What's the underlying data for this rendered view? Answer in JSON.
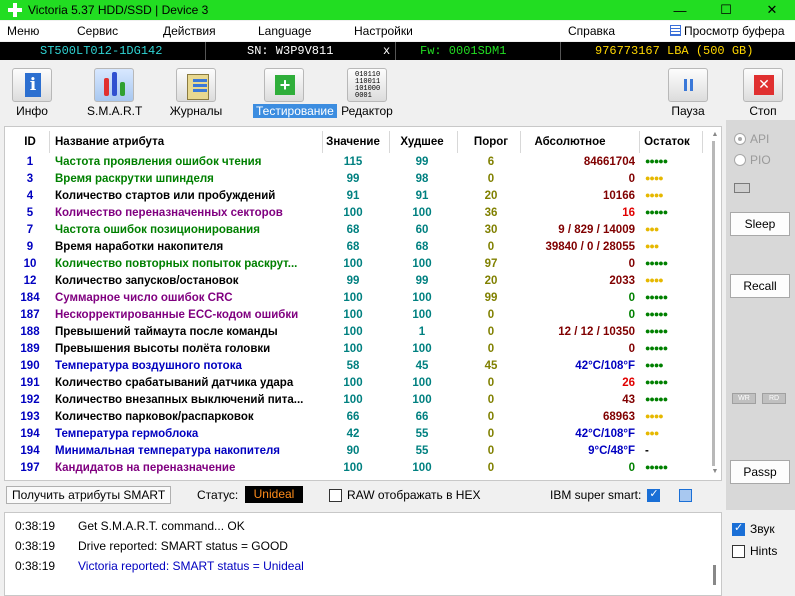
{
  "window": {
    "title": "Victoria 5.37 HDD/SSD | Device 3",
    "minimize": "—",
    "maximize": "☐",
    "close": "✕"
  },
  "menu": {
    "items": [
      "Меню",
      "Сервис",
      "Действия",
      "Language",
      "Настройки",
      "Справка"
    ],
    "buffer_view": "Просмотр буфера"
  },
  "drive_info": {
    "model": "ST500LT012-1DG142",
    "serial": "SN: W3P9V811",
    "eject": "x",
    "firmware": "Fw: 0001SDM1",
    "capacity": "976773167 LBA (500 GB)"
  },
  "toolbar": {
    "info": "Инфо",
    "smart": "S.M.A.R.T",
    "journals": "Журналы",
    "testing": "Тестирование",
    "editor": "Редактор",
    "pause": "Пауза",
    "stop": "Стоп",
    "editor_icon_lines": [
      "010110",
      "110011",
      "101000",
      "0001"
    ]
  },
  "smart_table": {
    "headers": {
      "id": "ID",
      "name": "Название атрибута",
      "value": "Значение",
      "worst": "Худшее",
      "threshold": "Порог",
      "raw": "Абсолютное",
      "remaining": "Остаток"
    },
    "rows": [
      {
        "id": "1",
        "name": "Частота проявления ошибок чтения",
        "value": "115",
        "worst": "99",
        "threshold": "6",
        "raw": "84661704",
        "dots": "●●●●●",
        "name_color": "#008000",
        "raw_color": "#800000",
        "dots_color": "#008000"
      },
      {
        "id": "3",
        "name": "Время раскрутки шпинделя",
        "value": "99",
        "worst": "98",
        "threshold": "0",
        "raw": "0",
        "dots": "●●●●",
        "name_color": "#008000",
        "raw_color": "#800000",
        "dots_color": "#e6b800"
      },
      {
        "id": "4",
        "name": "Количество стартов или пробуждений",
        "value": "91",
        "worst": "91",
        "threshold": "20",
        "raw": "10166",
        "dots": "●●●●",
        "name_color": "#000000",
        "raw_color": "#800000",
        "dots_color": "#e6b800"
      },
      {
        "id": "5",
        "name": "Количество переназначенных секторов",
        "value": "100",
        "worst": "100",
        "threshold": "36",
        "raw": "16",
        "dots": "●●●●●",
        "name_color": "#800080",
        "raw_color": "#e00000",
        "dots_color": "#008000"
      },
      {
        "id": "7",
        "name": "Частота ошибок позиционирования",
        "value": "68",
        "worst": "60",
        "threshold": "30",
        "raw": "9 / 829 / 14009",
        "dots": "●●●",
        "name_color": "#008000",
        "raw_color": "#800000",
        "dots_color": "#e6b800"
      },
      {
        "id": "9",
        "name": "Время наработки накопителя",
        "value": "68",
        "worst": "68",
        "threshold": "0",
        "raw": "39840 / 0 / 28055",
        "dots": "●●●",
        "name_color": "#000000",
        "raw_color": "#800000",
        "dots_color": "#e6b800"
      },
      {
        "id": "10",
        "name": "Количество повторных попыток раскрут...",
        "value": "100",
        "worst": "100",
        "threshold": "97",
        "raw": "0",
        "dots": "●●●●●",
        "name_color": "#008000",
        "raw_color": "#800000",
        "dots_color": "#008000"
      },
      {
        "id": "12",
        "name": "Количество запусков/остановок",
        "value": "99",
        "worst": "99",
        "threshold": "20",
        "raw": "2033",
        "dots": "●●●●",
        "name_color": "#000000",
        "raw_color": "#800000",
        "dots_color": "#e6b800"
      },
      {
        "id": "184",
        "name": "Суммарное число ошибок CRC",
        "value": "100",
        "worst": "100",
        "threshold": "99",
        "raw": "0",
        "dots": "●●●●●",
        "name_color": "#800080",
        "raw_color": "#008000",
        "dots_color": "#008000"
      },
      {
        "id": "187",
        "name": "Нескорректированные ECC-кодом ошибки",
        "value": "100",
        "worst": "100",
        "threshold": "0",
        "raw": "0",
        "dots": "●●●●●",
        "name_color": "#800080",
        "raw_color": "#008000",
        "dots_color": "#008000"
      },
      {
        "id": "188",
        "name": "Превышений таймаута после команды",
        "value": "100",
        "worst": "1",
        "threshold": "0",
        "raw": "12 / 12 / 10350",
        "dots": "●●●●●",
        "name_color": "#000000",
        "raw_color": "#800000",
        "dots_color": "#008000"
      },
      {
        "id": "189",
        "name": "Превышения высоты полёта головки",
        "value": "100",
        "worst": "100",
        "threshold": "0",
        "raw": "0",
        "dots": "●●●●●",
        "name_color": "#000000",
        "raw_color": "#800000",
        "dots_color": "#008000"
      },
      {
        "id": "190",
        "name": "Температура воздушного потока",
        "value": "58",
        "worst": "45",
        "threshold": "45",
        "raw": "42°C/108°F",
        "dots": "●●●●",
        "name_color": "#0000c0",
        "raw_color": "#0000c0",
        "dots_color": "#008000"
      },
      {
        "id": "191",
        "name": "Количество срабатываний датчика удара",
        "value": "100",
        "worst": "100",
        "threshold": "0",
        "raw": "26",
        "dots": "●●●●●",
        "name_color": "#000000",
        "raw_color": "#e00000",
        "dots_color": "#008000"
      },
      {
        "id": "192",
        "name": "Количество внезапных выключений пита...",
        "value": "100",
        "worst": "100",
        "threshold": "0",
        "raw": "43",
        "dots": "●●●●●",
        "name_color": "#000000",
        "raw_color": "#800000",
        "dots_color": "#008000"
      },
      {
        "id": "193",
        "name": "Количество парковок/распарковок",
        "value": "66",
        "worst": "66",
        "threshold": "0",
        "raw": "68963",
        "dots": "●●●●",
        "name_color": "#000000",
        "raw_color": "#800000",
        "dots_color": "#e6b800"
      },
      {
        "id": "194",
        "name": "Температура гермоблока",
        "value": "42",
        "worst": "55",
        "threshold": "0",
        "raw": "42°C/108°F",
        "dots": "●●●",
        "name_color": "#0000c0",
        "raw_color": "#0000c0",
        "dots_color": "#e6b800"
      },
      {
        "id": "194",
        "name": "Минимальная температура накопителя",
        "value": "90",
        "worst": "55",
        "threshold": "0",
        "raw": "9°C/48°F",
        "dots": "-",
        "name_color": "#0000c0",
        "raw_color": "#0000c0",
        "dots_color": "#000000"
      },
      {
        "id": "197",
        "name": "Кандидатов на переназначение",
        "value": "100",
        "worst": "100",
        "threshold": "0",
        "raw": "0",
        "dots": "●●●●●",
        "name_color": "#800080",
        "raw_color": "#008000",
        "dots_color": "#008000"
      }
    ]
  },
  "side_panel": {
    "api": "API",
    "pio": "PIO",
    "sleep": "Sleep",
    "recall": "Recall",
    "passp": "Passp",
    "wr": "WR",
    "rd": "RD"
  },
  "status_bar": {
    "get_smart": "Получить атрибуты SMART",
    "status_label": "Статус:",
    "status_value": "Unideal",
    "raw_hex": "RAW отображать в HEX",
    "ibm": "IBM super smart:"
  },
  "log": {
    "entries": [
      {
        "time": "0:38:19",
        "msg": "Get S.M.A.R.T. command... OK",
        "color": "#000000"
      },
      {
        "time": "0:38:19",
        "msg": "Drive reported: SMART status = GOOD",
        "color": "#000000"
      },
      {
        "time": "0:38:19",
        "msg": "Victoria reported: SMART status = Unideal",
        "color": "#0000c0"
      }
    ]
  },
  "bottom_right": {
    "sound": "Звук",
    "hints": "Hints"
  },
  "colors": {
    "titlebar": "#22dd22",
    "id_color": "#0000c0",
    "value_color": "#008080",
    "worst_color": "#008080",
    "threshold_color": "#808000"
  }
}
